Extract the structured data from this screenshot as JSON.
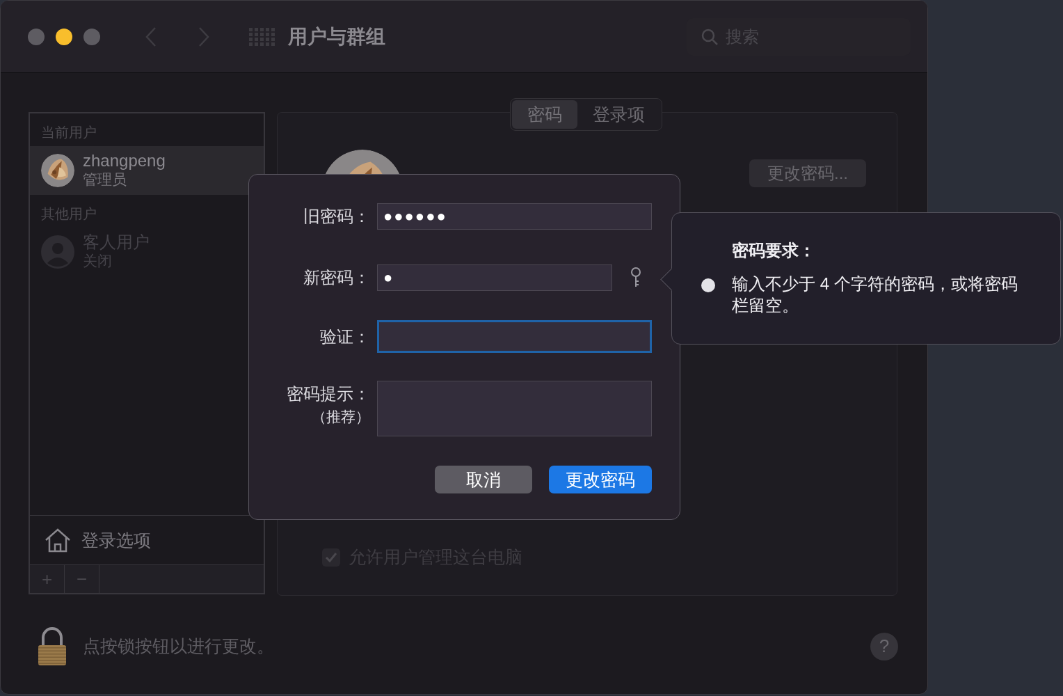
{
  "window": {
    "title": "用户与群组"
  },
  "search": {
    "placeholder": "搜索"
  },
  "sidebar": {
    "sections": [
      {
        "heading": "当前用户",
        "users": [
          {
            "name": "zhangpeng",
            "role": "管理员",
            "selected": true
          }
        ]
      },
      {
        "heading": "其他用户",
        "users": [
          {
            "name": "客人用户",
            "role": "关闭",
            "selected": false,
            "kind": "silhouette"
          }
        ]
      }
    ],
    "login_options": "登录选项",
    "add": "+",
    "remove": "−"
  },
  "tabs": [
    {
      "label": "密码",
      "selected": true
    },
    {
      "label": "登录项",
      "selected": false
    }
  ],
  "change_password_button": "更改密码...",
  "admin_checkbox": {
    "label": "允许用户管理这台电脑",
    "checked": true
  },
  "dialog": {
    "fields": [
      {
        "label": "旧密码：",
        "value": "●●●●●●",
        "focused": false,
        "kind": "password"
      },
      {
        "label": "新密码：",
        "value": "●",
        "focused": false,
        "kind": "password_key"
      },
      {
        "label": "验证：",
        "focused": true,
        "kind": "password"
      },
      {
        "label": "密码提示：",
        "sublabel": "（推荐）",
        "focused": false,
        "kind": "textarea"
      }
    ],
    "buttons": [
      {
        "label": "取消",
        "kind": "secondary"
      },
      {
        "label": "更改密码",
        "kind": "primary"
      }
    ]
  },
  "popover": {
    "title": "密码要求：",
    "requirements": [
      "输入不少于 4 个字符的密码，或将密码栏留空。"
    ]
  },
  "status_bar": {
    "text": "点按锁按钮以进行更改。",
    "help": "?"
  }
}
